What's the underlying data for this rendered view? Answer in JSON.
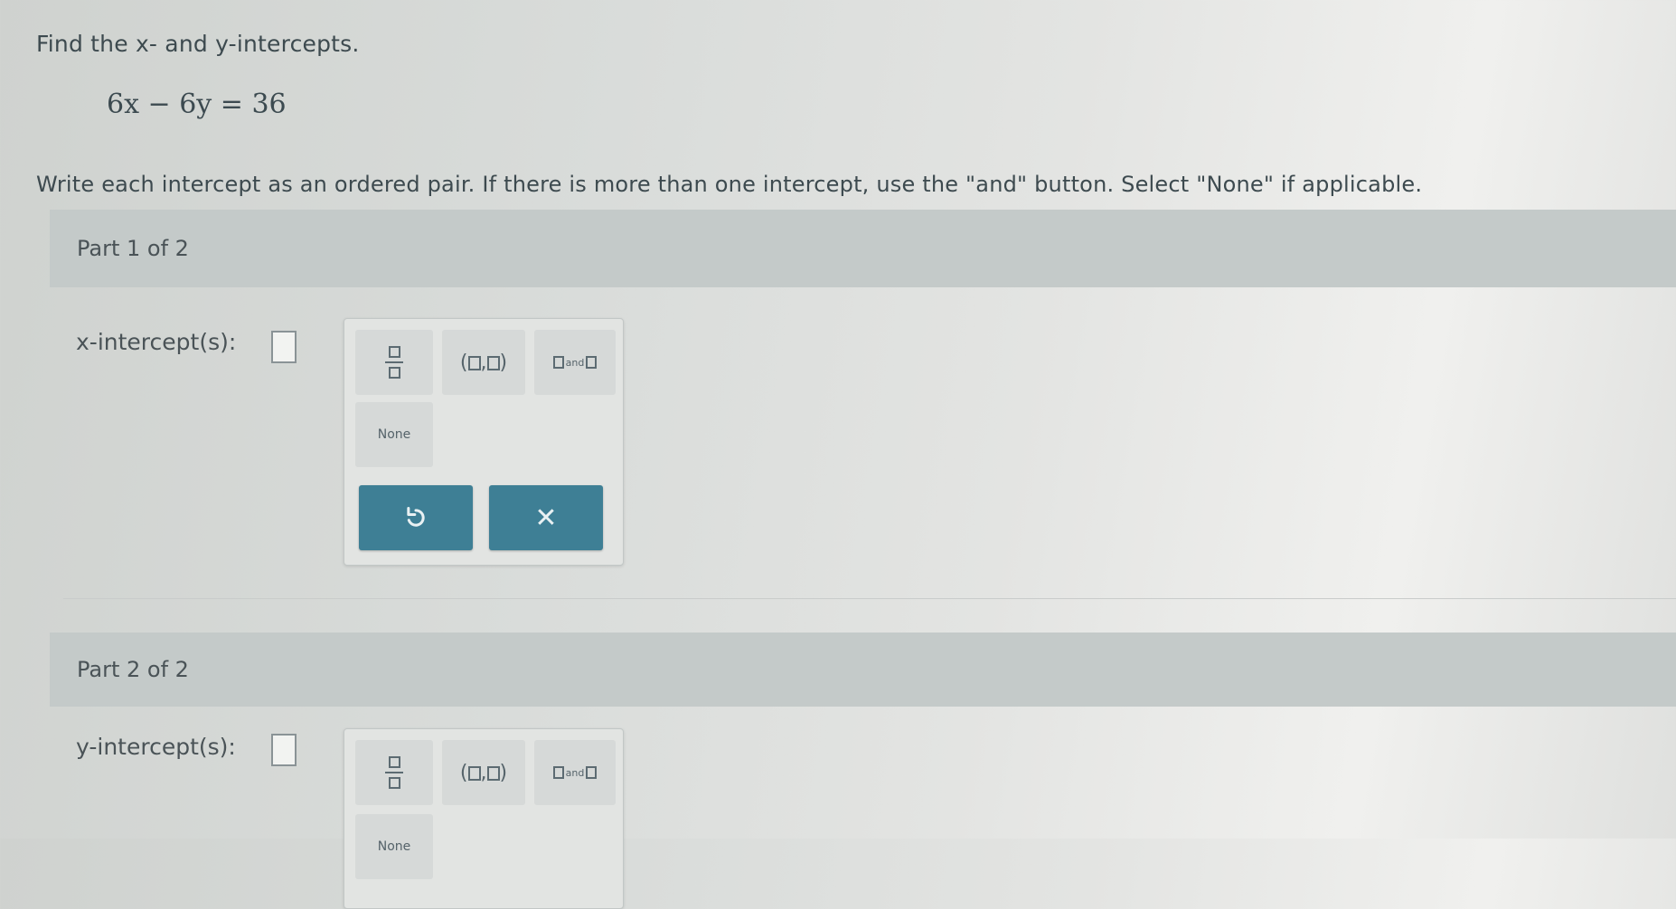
{
  "question": {
    "prompt": "Find the x- and y-intercepts.",
    "equation": "6x − 6y = 36",
    "instructions": "Write each intercept as an ordered pair. If there is more than one intercept, use the \"and\" button. Select \"None\" if applicable."
  },
  "part1": {
    "header": "Part 1 of 2",
    "label": "x-intercept(s):",
    "keypad": {
      "ordered_pair_left": "(",
      "ordered_pair_comma": ",",
      "ordered_pair_right": ")",
      "and_label": "and",
      "none_label": "None",
      "undo_icon": "undo-icon",
      "clear_icon": "✕"
    }
  },
  "part2": {
    "header": "Part 2 of 2",
    "label": "y-intercept(s):",
    "keypad": {
      "ordered_pair_left": "(",
      "ordered_pair_comma": ",",
      "ordered_pair_right": ")",
      "and_label": "and",
      "none_label": "None"
    }
  },
  "colors": {
    "action_button": "#3e7f95",
    "part_bar": "#c4cac9"
  }
}
